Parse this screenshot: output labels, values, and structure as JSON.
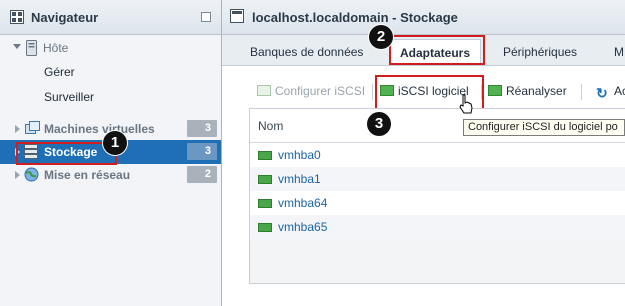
{
  "navigator": {
    "title": "Navigateur",
    "host": {
      "label": "Hôte",
      "children": [
        "Gérer",
        "Surveiller"
      ]
    },
    "items": [
      {
        "label": "Machines virtuelles",
        "count": "3"
      },
      {
        "label": "Stockage",
        "count": "3",
        "selected": true
      },
      {
        "label": "Mise en réseau",
        "count": "2"
      }
    ]
  },
  "main": {
    "title": "localhost.localdomain - Stockage",
    "tabs": [
      "Banques de données",
      "Adaptateurs",
      "Périphériques",
      "M"
    ],
    "active_tab": "Adaptateurs",
    "toolbar": {
      "configure_iscsi": "Configurer iSCSI",
      "software_iscsi": "iSCSI logiciel",
      "rescan": "Réanalyser",
      "refresh_partial": "Ac"
    },
    "tooltip": "Configurer iSCSI du logiciel po",
    "table": {
      "column": "Nom",
      "rows": [
        "vmhba0",
        "vmhba1",
        "vmhba64",
        "vmhba65"
      ]
    }
  },
  "markers": [
    "1",
    "2",
    "3"
  ],
  "colors": {
    "selection": "#1f6fb6",
    "highlight": "#d11d1d",
    "adapter_icon": "#4aa64a"
  }
}
